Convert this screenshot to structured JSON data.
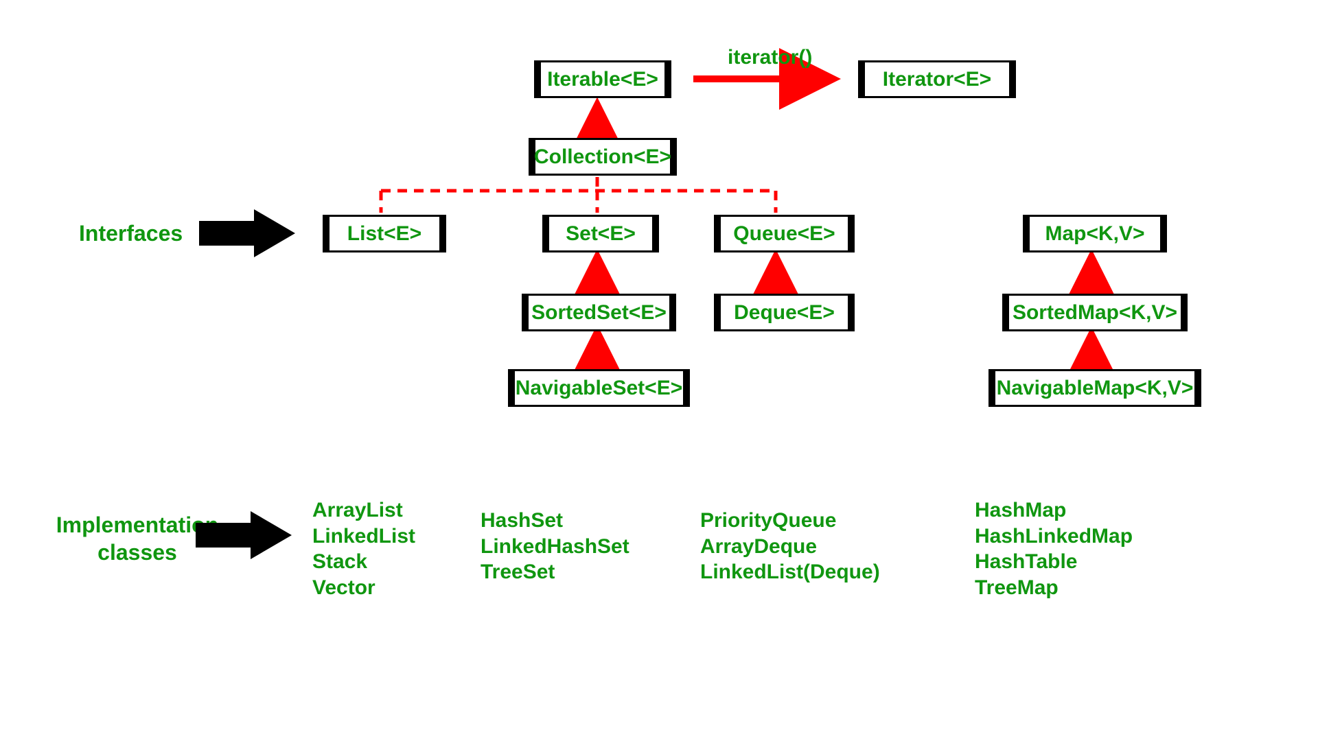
{
  "labels": {
    "interfaces": "Interfaces",
    "implementationClasses": "Implementation\nclasses",
    "iteratorMethod": "iterator()"
  },
  "nodes": {
    "iterable": "Iterable<E>",
    "iterator": "Iterator<E>",
    "collection": "Collection<E>",
    "list": "List<E>",
    "set": "Set<E>",
    "queue": "Queue<E>",
    "sortedSet": "SortedSet<E>",
    "navigableSet": "NavigableSet<E>",
    "deque": "Deque<E>",
    "map": "Map<K,V>",
    "sortedMap": "SortedMap<K,V>",
    "navigableMap": "NavigableMap<K,V>"
  },
  "impls": {
    "list": [
      "ArrayList",
      "LinkedList",
      "Stack",
      "Vector"
    ],
    "set": [
      "HashSet",
      "LinkedHashSet",
      "TreeSet"
    ],
    "queue": [
      "PriorityQueue",
      "ArrayDeque",
      "LinkedList(Deque)"
    ],
    "map": [
      "HashMap",
      "HashLinkedMap",
      "HashTable",
      "TreeMap"
    ]
  },
  "colors": {
    "text": "#109610",
    "arrow": "#FF0000",
    "boxBorder": "#000000"
  }
}
